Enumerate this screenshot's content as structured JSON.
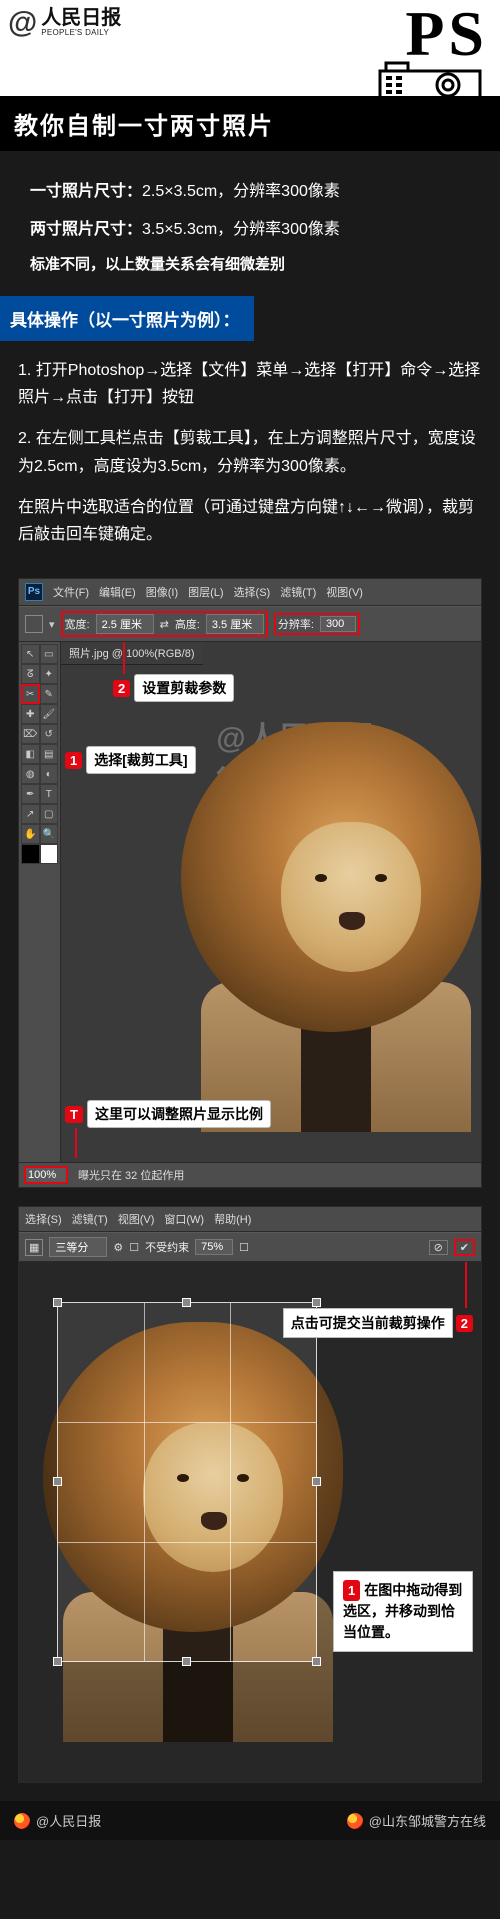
{
  "header": {
    "logo_cn": "人民日报",
    "logo_en": "PEOPLE'S DAILY",
    "at": "@",
    "ps": "PS"
  },
  "title": "教你自制一寸两寸照片",
  "spec": {
    "one_label": "一寸照片尺寸：",
    "one_value": "2.5×3.5cm，分辨率300像素",
    "two_label": "两寸照片尺寸：",
    "two_value": "3.5×5.3cm，分辨率300像素",
    "note": "标准不同，以上数量关系会有细微差别"
  },
  "section_head": "具体操作（以一寸照片为例）：",
  "steps": {
    "s1": "1. 打开Photoshop→选择【文件】菜单→选择【打开】命令→选择照片→点击【打开】按钮",
    "s2": "2. 在左侧工具栏点击【剪裁工具】，在上方调整照片尺寸，宽度设为2.5cm，高度设为3.5cm，分辨率为300像素。",
    "s3": "在照片中选取适合的位置（可通过键盘方向键↑↓←→微调），裁剪后敲击回车键确定。"
  },
  "ps1": {
    "menubar": [
      "文件(F)",
      "编辑(E)",
      "图像(I)",
      "图层(L)",
      "选择(S)",
      "滤镜(T)",
      "视图(V)"
    ],
    "option_width_label": "宽度:",
    "option_width_value": "2.5 厘米",
    "option_height_label": "高度:",
    "option_height_value": "3.5 厘米",
    "option_res_label": "分辨率:",
    "option_res_value": "300",
    "tab": "照片.jpg @ 100%(RGB/8)",
    "ann2_badge": "2",
    "ann2_text": "设置剪裁参数",
    "ann1_badge": "1",
    "ann1_text": "选择[裁剪工具]",
    "annT_badge": "T",
    "annT_text": "这里可以调整照片显示比例",
    "zoom": "100%",
    "status_hint": "曝光只在 32 位起作用",
    "watermark": "@人民日报微博"
  },
  "ps2": {
    "menubar_frag": [
      "选择(S)",
      "滤镜(T)",
      "视图(V)",
      "窗口(W)",
      "帮助(H)"
    ],
    "option_frag_label": "三等分",
    "option_unconstrained": "不受约束",
    "ratio": "75%",
    "ann2_badge": "2",
    "ann2_text": "点击可提交当前裁剪操作",
    "side_badge": "1",
    "side_text": "在图中拖动得到选区，并移动到恰当位置。"
  },
  "footer": {
    "left": "@人民日报",
    "right": "@山东邹城警方在线"
  }
}
